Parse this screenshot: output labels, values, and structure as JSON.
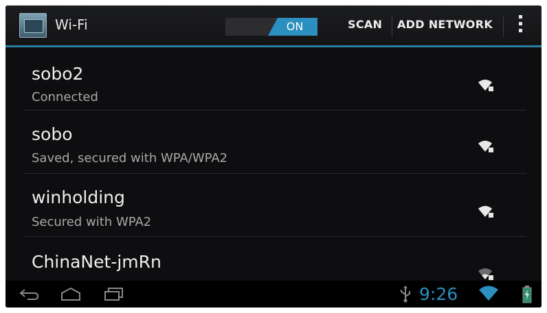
{
  "action_bar": {
    "title": "Wi-Fi",
    "toggle_label": "ON",
    "scan_label": "SCAN",
    "add_network_label": "ADD NETWORK"
  },
  "networks": [
    {
      "ssid": "sobo2",
      "status": "Connected",
      "icon": "wifi-secured-signal-icon"
    },
    {
      "ssid": "sobo",
      "status": "Saved, secured with WPA/WPA2",
      "icon": "wifi-secured-signal-icon"
    },
    {
      "ssid": "winholding",
      "status": "Secured with WPA2",
      "icon": "wifi-secured-signal-icon"
    },
    {
      "ssid": "ChinaNet-jmRn",
      "status": "",
      "icon": "wifi-secured-weak-signal-icon"
    }
  ],
  "system_bar": {
    "time": "9:26",
    "icons": [
      "back-icon",
      "home-icon",
      "recent-apps-icon",
      "usb-icon",
      "wifi-status-icon",
      "battery-icon"
    ]
  },
  "colors": {
    "accent": "#2b8fbf",
    "background": "#0d0d0e",
    "primary_text": "#efefef",
    "secondary_text": "#a8a8a8"
  }
}
